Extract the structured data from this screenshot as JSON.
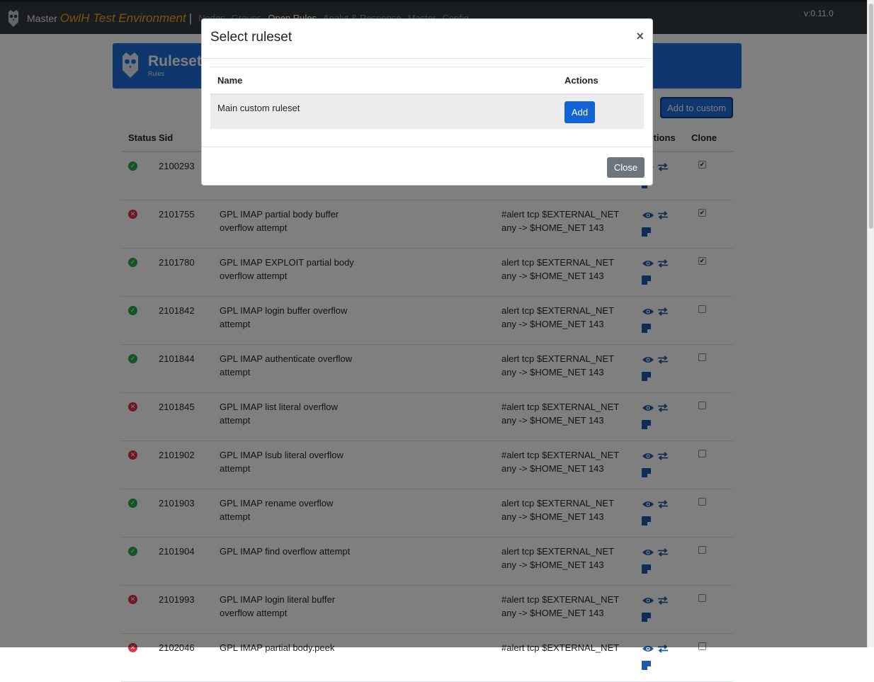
{
  "navbar": {
    "brand": "Master",
    "environment": "OwlH Test Environment",
    "separator": "|",
    "links": [
      "Nodes",
      "Groups",
      "Open Rules",
      "Analyt & Response",
      "Master",
      "Config"
    ],
    "active_link": "Open Rules",
    "version": "v:0.11.0"
  },
  "page_header": {
    "title": "Ruleset",
    "subtitle": "Rules"
  },
  "add_to_custom_label": "Add to custom",
  "rules_table": {
    "headers": {
      "status": "Status",
      "sid": "Sid",
      "actions": "Actions",
      "clone": "Clone"
    },
    "rows": [
      {
        "status": "enabled",
        "sid": "2100293",
        "description": "",
        "definition": "",
        "clone": true
      },
      {
        "status": "disabled",
        "sid": "2101755",
        "description": "GPL IMAP partial body buffer overflow attempt",
        "definition": "#alert tcp $EXTERNAL_NET any -> $HOME_NET 143",
        "clone": true
      },
      {
        "status": "enabled",
        "sid": "2101780",
        "description": "GPL IMAP EXPLOIT partial body overflow attempt",
        "definition": "alert tcp $EXTERNAL_NET any -> $HOME_NET 143",
        "clone": true
      },
      {
        "status": "enabled",
        "sid": "2101842",
        "description": "GPL IMAP login buffer overflow attempt",
        "definition": "alert tcp $EXTERNAL_NET any -> $HOME_NET 143",
        "clone": false
      },
      {
        "status": "enabled",
        "sid": "2101844",
        "description": "GPL IMAP authenticate overflow attempt",
        "definition": "alert tcp $EXTERNAL_NET any -> $HOME_NET 143",
        "clone": false
      },
      {
        "status": "disabled",
        "sid": "2101845",
        "description": "GPL IMAP list literal overflow attempt",
        "definition": "#alert tcp $EXTERNAL_NET any -> $HOME_NET 143",
        "clone": false
      },
      {
        "status": "disabled",
        "sid": "2101902",
        "description": "GPL IMAP lsub literal overflow attempt",
        "definition": "#alert tcp $EXTERNAL_NET any -> $HOME_NET 143",
        "clone": false
      },
      {
        "status": "enabled",
        "sid": "2101903",
        "description": "GPL IMAP rename overflow attempt",
        "definition": "alert tcp $EXTERNAL_NET any -> $HOME_NET 143",
        "clone": false
      },
      {
        "status": "enabled",
        "sid": "2101904",
        "description": "GPL IMAP find overflow attempt",
        "definition": "alert tcp $EXTERNAL_NET any -> $HOME_NET 143",
        "clone": false
      },
      {
        "status": "disabled",
        "sid": "2101993",
        "description": "GPL IMAP login literal buffer overflow attempt",
        "definition": "#alert tcp $EXTERNAL_NET any -> $HOME_NET 143",
        "clone": false
      },
      {
        "status": "disabled",
        "sid": "2102046",
        "description": "GPL IMAP partial body.peek",
        "definition": "#alert tcp $EXTERNAL_NET",
        "clone": false
      }
    ]
  },
  "modal": {
    "title": "Select ruleset",
    "close_symbol": "×",
    "table_headers": {
      "name": "Name",
      "actions": "Actions"
    },
    "rows": [
      {
        "name": "Main custom ruleset",
        "action_label": "Add"
      }
    ],
    "close_button_label": "Close"
  },
  "colors": {
    "navbar": "#343a40",
    "environment_text": "#f6a623",
    "primary": "#1e6fdc",
    "status_enabled": "#28a745",
    "status_disabled": "#dc3545",
    "secondary_button": "#6c757d"
  }
}
